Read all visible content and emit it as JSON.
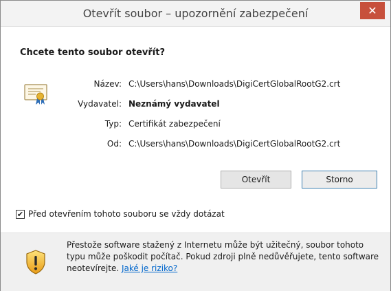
{
  "dialog": {
    "title": "Otevřít soubor – upozornění zabezpečení",
    "close_symbol": "✕",
    "question": "Chcete tento soubor otevřít?",
    "icons": {
      "file": "certificate-icon",
      "warning": "shield-warning-icon",
      "close": "close-icon"
    }
  },
  "fields": [
    {
      "label": "Název:",
      "value": "C:\\Users\\hans\\Downloads\\DigiCertGlobalRootG2.crt",
      "bold": false
    },
    {
      "label": "Vydavatel:",
      "value": "Neznámý vydavatel",
      "bold": true
    },
    {
      "label": "Typ:",
      "value": "Certifikát zabezpečení",
      "bold": false
    },
    {
      "label": "Od:",
      "value": "C:\\Users\\hans\\Downloads\\DigiCertGlobalRootG2.crt",
      "bold": false
    }
  ],
  "buttons": {
    "open": "Otevřít",
    "cancel": "Storno"
  },
  "checkbox": {
    "label": "Před otevřením tohoto souboru se vždy dotázat",
    "checked": true,
    "mark": "✔"
  },
  "warning": {
    "text": "Přestože software stažený z Internetu může být užitečný, soubor tohoto typu může poškodit počítač. Pokud zdroji plně nedůvěřujete, tento software neotevírejte.",
    "link": "Jaké je riziko?"
  },
  "colors": {
    "close_button": "#c7503c",
    "link": "#0066cc",
    "default_button_border": "#3c7fb1"
  }
}
